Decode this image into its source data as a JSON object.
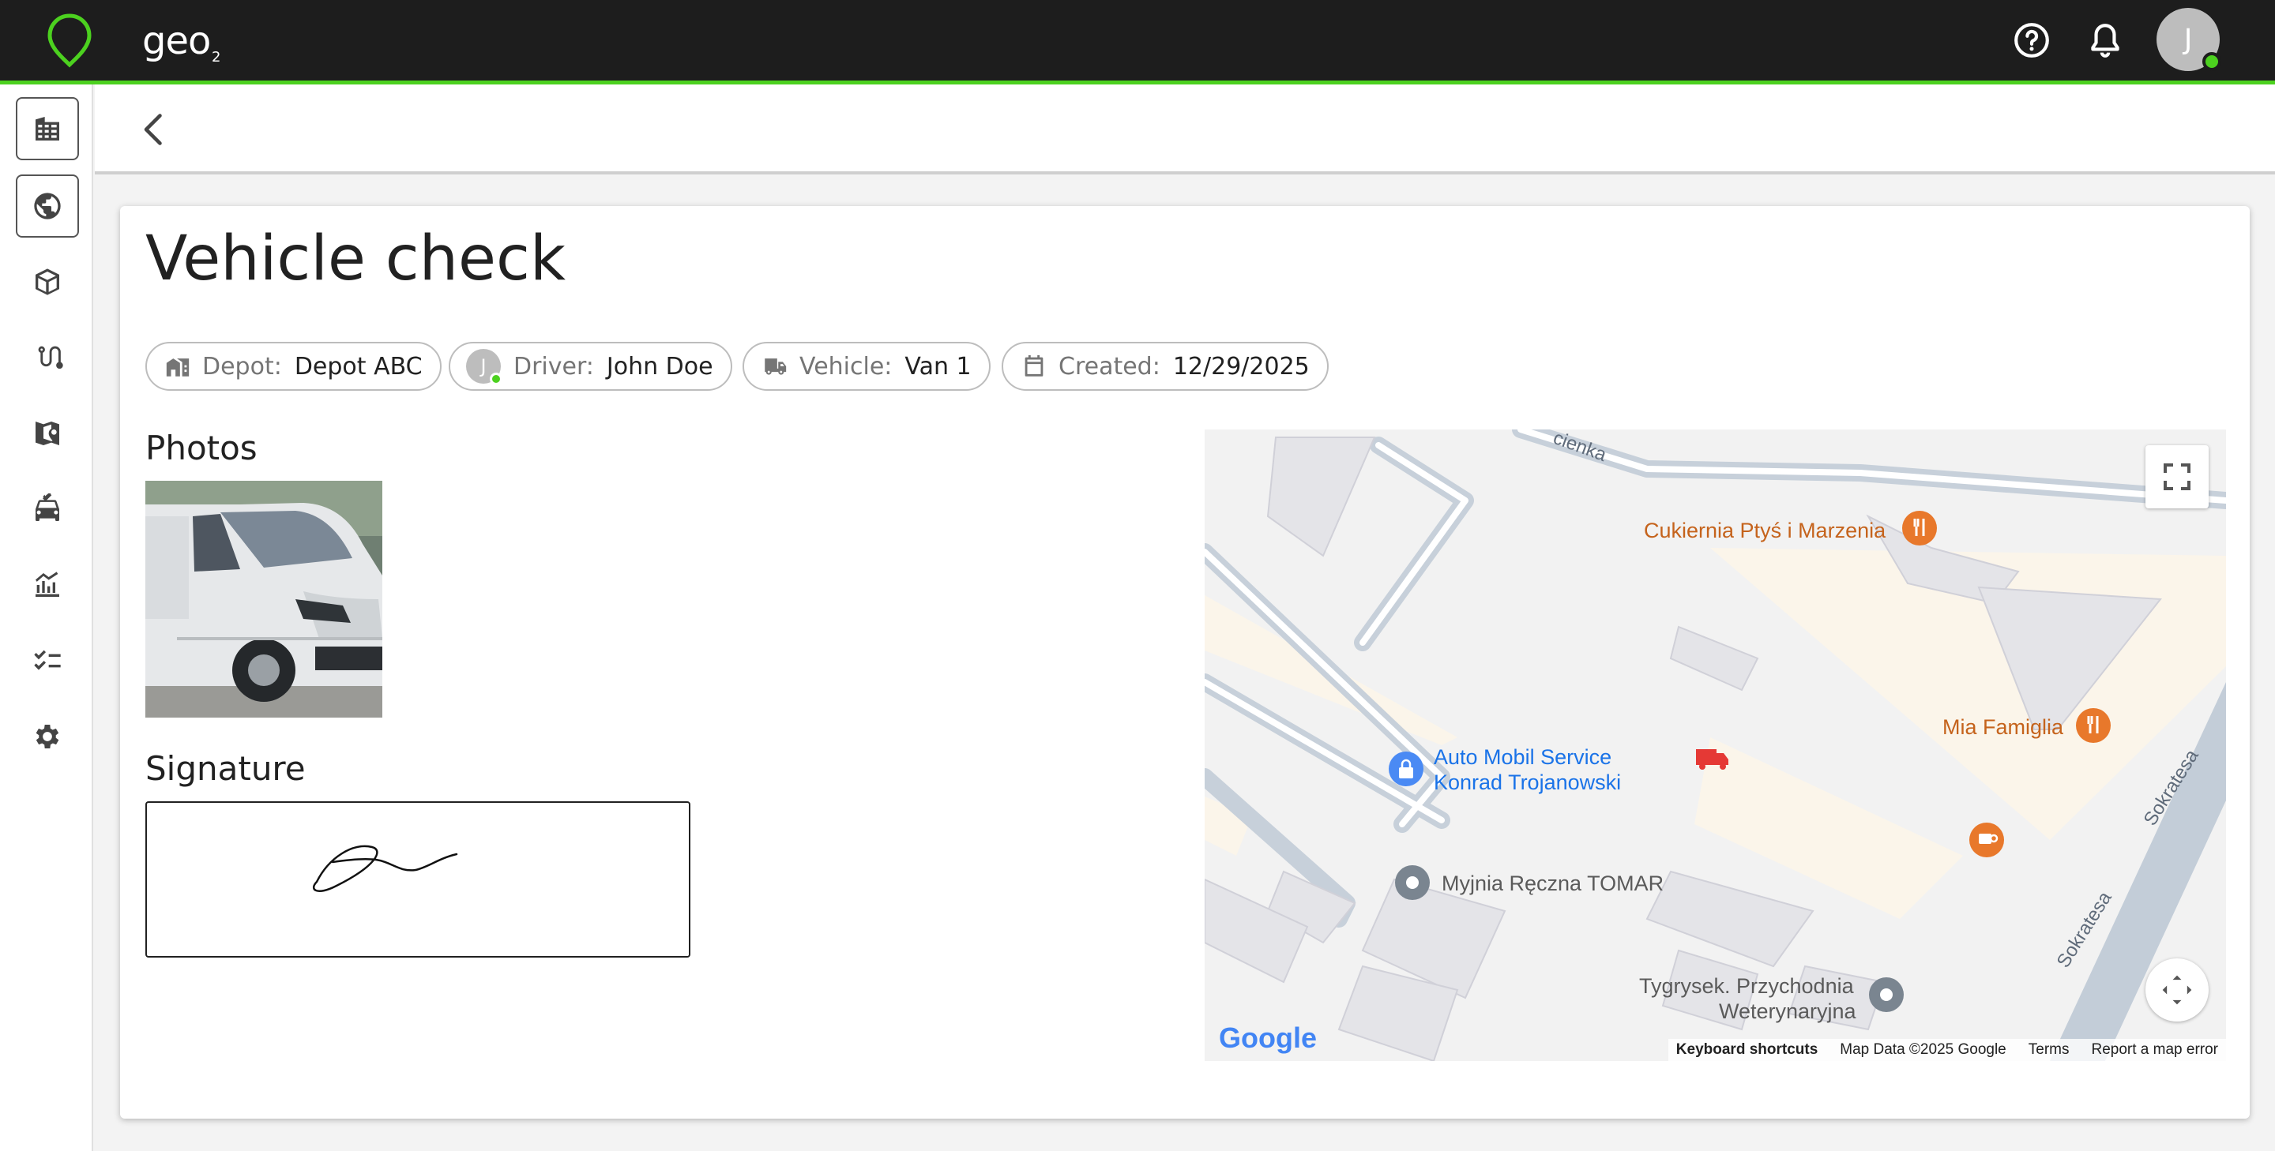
{
  "app": {
    "logo_text": "geo",
    "logo_sub": "2",
    "user_initial": "J",
    "accent": "#4cd11f"
  },
  "icons": {
    "help": "help-circle-icon",
    "notifications": "bell-icon",
    "back": "chevron-left-icon"
  },
  "sidebar": {
    "items": [
      {
        "name": "buildings-icon"
      },
      {
        "name": "globe-icon"
      },
      {
        "name": "package-icon"
      },
      {
        "name": "route-icon"
      },
      {
        "name": "map-pin-icon"
      },
      {
        "name": "vehicle-check-icon"
      },
      {
        "name": "analytics-icon"
      },
      {
        "name": "checklist-icon"
      },
      {
        "name": "settings-icon"
      }
    ]
  },
  "page": {
    "title": "Vehicle check",
    "chips": {
      "depot": {
        "label": "Depot:",
        "value": "Depot ABC"
      },
      "driver": {
        "label": "Driver:",
        "value": "John Doe",
        "initial": "J"
      },
      "vehicle": {
        "label": "Vehicle:",
        "value": "Van 1"
      },
      "created": {
        "label": "Created:",
        "value": "12/29/2025"
      }
    },
    "photos_heading": "Photos",
    "signature_heading": "Signature"
  },
  "map": {
    "places": {
      "cukiernia": "Cukiernia Ptyś i Marzenia",
      "mia": "Mia Famiglia",
      "auto_line1": "Auto Mobil Service",
      "auto_line2": "Konrad Trojanowski",
      "myjnia": "Myjnia Ręczna TOMAR",
      "tygrysek_line1": "Tygrysek. Przychodnia",
      "tygrysek_line2": "Weterynaryjna"
    },
    "streets": {
      "top": "cienka",
      "sokratesa1": "Sokratesa",
      "sokratesa2": "Sokratesa"
    },
    "google": "Google",
    "footer": {
      "shortcuts": "Keyboard shortcuts",
      "data": "Map Data ©2025 Google",
      "terms": "Terms",
      "report": "Report a map error"
    }
  }
}
